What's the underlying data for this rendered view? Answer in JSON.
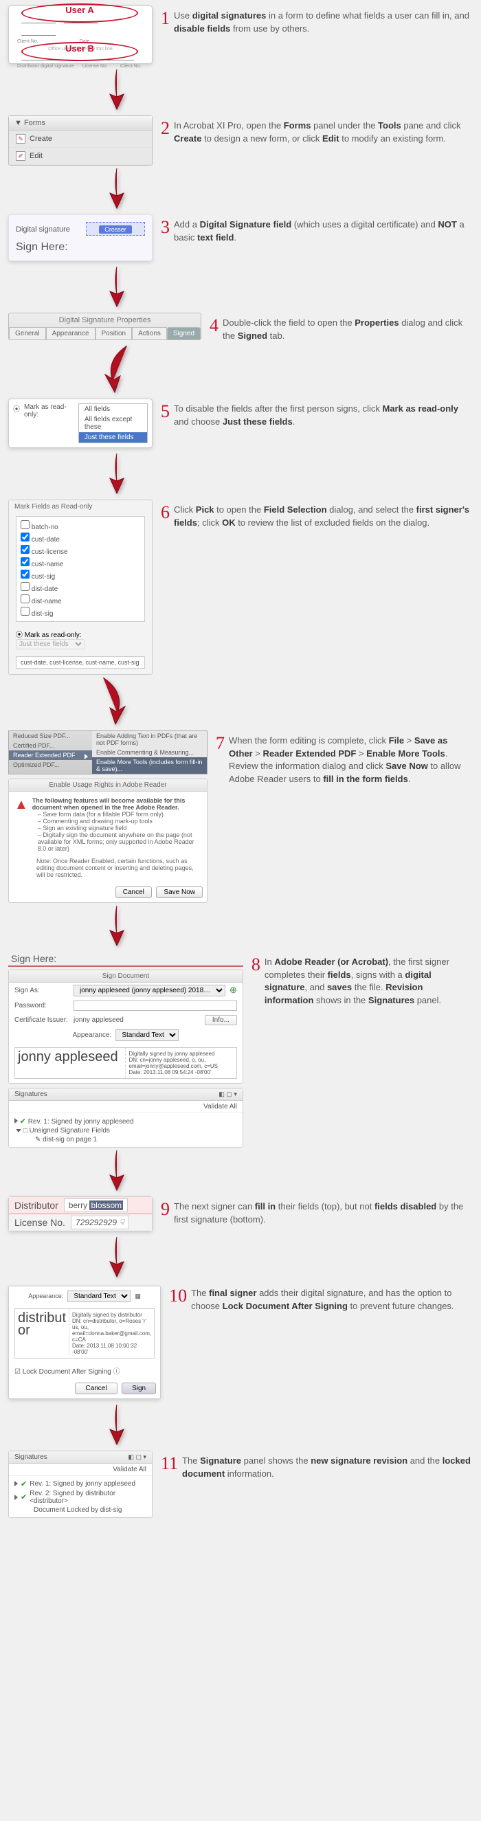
{
  "step1": {
    "ovalA": "User A",
    "ovalB": "User B",
    "formLabels": [
      "Client No.",
      "Date",
      "Distributor digital signature",
      "License No.",
      "Client No."
    ],
    "centerText": "Office use only before this line",
    "text": "Use <b>digital signatures</b> in a form to define what fields a user can fill in, and <b>disable fields</b> from use by others."
  },
  "step2": {
    "panelTitle": "Forms",
    "create": "Create",
    "edit": "Edit",
    "text": "In Acrobat XI Pro, open the <b>Forms</b> panel under the <b>Tools</b> pane and click <b>Create</b> to design a new form, or click <b>Edit</b> to modify an existing form."
  },
  "step3": {
    "label": "Digital signature",
    "btn": "Crosser",
    "signHere": "Sign Here:",
    "text": "Add a <b>Digital Signature field</b> (which uses a digital certificate) and <b>NOT</b> a basic <b>text field</b>."
  },
  "step4": {
    "title": "Digital Signature Properties",
    "tabs": [
      "General",
      "Appearance",
      "Position",
      "Actions",
      "Signed"
    ],
    "text": "Double-click the field to open the <b>Properties</b> dialog and click the <b>Signed</b> tab."
  },
  "step5": {
    "label": "Mark as read-only:",
    "options": [
      "All fields",
      "All fields except these",
      "Just these fields"
    ],
    "text": "To disable the fields after the first person signs, click <b>Mark as read-only</b> and choose <b>Just these fields</b>."
  },
  "step6": {
    "title": "Mark Fields as Read-only",
    "fields": [
      {
        "name": "batch-no",
        "checked": false
      },
      {
        "name": "cust-date",
        "checked": true
      },
      {
        "name": "cust-license",
        "checked": true
      },
      {
        "name": "cust-name",
        "checked": true
      },
      {
        "name": "cust-sig",
        "checked": true
      },
      {
        "name": "dist-date",
        "checked": false
      },
      {
        "name": "dist-name",
        "checked": false
      },
      {
        "name": "dist-sig",
        "checked": false
      }
    ],
    "footLabel": "Mark as read-only:",
    "footValue": "Just these fields",
    "output": "cust-date, cust-license, cust-name, cust-sig",
    "text": "Click <b>Pick</b> to open the <b>Field Selection</b> dialog, and select the <b>first signer's fields</b>; click <b>OK</b> to review the list of excluded fields on the dialog."
  },
  "step7": {
    "leftMenu": [
      "Reduced Size PDF...",
      "Certified PDF...",
      "Reader Extended PDF",
      "Optimized PDF..."
    ],
    "rightMenu": [
      "Enable Adding Text in PDFs (that are not PDF forms)",
      "Enable Commenting & Measuring...",
      "Enable More Tools (includes form fill-in & save)..."
    ],
    "rightsTitle": "Enable Usage Rights in Adobe Reader",
    "rightsIntro": "The following features will become available for this document when opened in the free Adobe Reader.",
    "rightsItems": [
      "Save form data (for a fillable PDF form only)",
      "Commenting and drawing mark-up tools",
      "Sign an existing signature field",
      "Digitally sign the document anywhere on the page (not available for XML forms; only supported in Adobe Reader 8.0 or later)"
    ],
    "rightsNote": "Note: Once Reader Enabled, certain functions, such as editing document content or inserting and deleting pages, will be restricted.",
    "cancel": "Cancel",
    "saveNow": "Save Now",
    "text": "When the form editing is complete, click <b>File</b> > <b>Save as Other</b> > <b>Reader Extended PDF</b> > <b>Enable More Tools</b>. Review the information dialog and click <b>Save Now</b> to allow Adobe Reader users to <b>fill in the form fields</b>."
  },
  "step8": {
    "signHere": "Sign Here:",
    "signDocTitle": "Sign Document",
    "signAsLabel": "Sign As:",
    "signAsValue": "jonny appleseed (jonny appleseed) 2018…",
    "passwordLabel": "Password:",
    "certLabel": "Certificate Issuer:",
    "certValue": "jonny appleseed",
    "infoBtn": "Info...",
    "appearanceLabel": "Appearance:",
    "appearanceValue": "Standard Text",
    "sigName": "jonny appleseed",
    "sigMeta": "Digitally signed by jonny appleseed\nDN: cn=jonny appleseed, o, ou, email=jonny@appleseed.com, c=US\nDate: 2013.11.08 09:54:24 -08'00'",
    "sigPanelTitle": "Signatures",
    "validateAll": "Validate All",
    "revLine": "Rev. 1: Signed by jonny appleseed",
    "unsigned": "Unsigned Signature Fields",
    "pageLine": "dist-sig on page 1",
    "text": "In <b>Adobe Reader (or Acrobat)</b>, the first signer completes their <b>fields</b>, signs with a <b>digital signature</b>, and <b>saves</b> the file. <b>Revision information</b> shows in the <b>Signatures</b> panel."
  },
  "step9": {
    "distributor": "Distributor",
    "distVal1": "berry",
    "distVal2": "blossom",
    "license": "License No.",
    "licVal": "729292929",
    "text": "The next signer can <b>fill in</b> their fields (top), but not <b>fields disabled</b> by the first signature (bottom)."
  },
  "step10": {
    "appearanceLabel": "Appearance:",
    "appearanceValue": "Standard Text",
    "sigName": "distributor",
    "sigMeta": "Digitally signed by distributor\nDN: cn=distributor, o=Roses 'r' us, ou, email=donna.baker@gmail.com, c=CA\nDate: 2013.11.08 10:00:32 -08'00'",
    "lockLabel": "Lock Document After Signing",
    "cancel": "Cancel",
    "sign": "Sign",
    "text": "The <b>final signer</b> adds their digital signature, and has the option to choose <b>Lock Document After Signing</b> to prevent future changes."
  },
  "step11": {
    "title": "Signatures",
    "validate": "Validate All",
    "rev1": "Rev. 1: Signed by jonny appleseed",
    "rev2": "Rev. 2: Signed by distributor <distributor>",
    "locked": "Document Locked by dist-sig",
    "text": "The <b>Signature</b> panel shows the <b>new signature revision</b> and the <b>locked document</b> information."
  }
}
